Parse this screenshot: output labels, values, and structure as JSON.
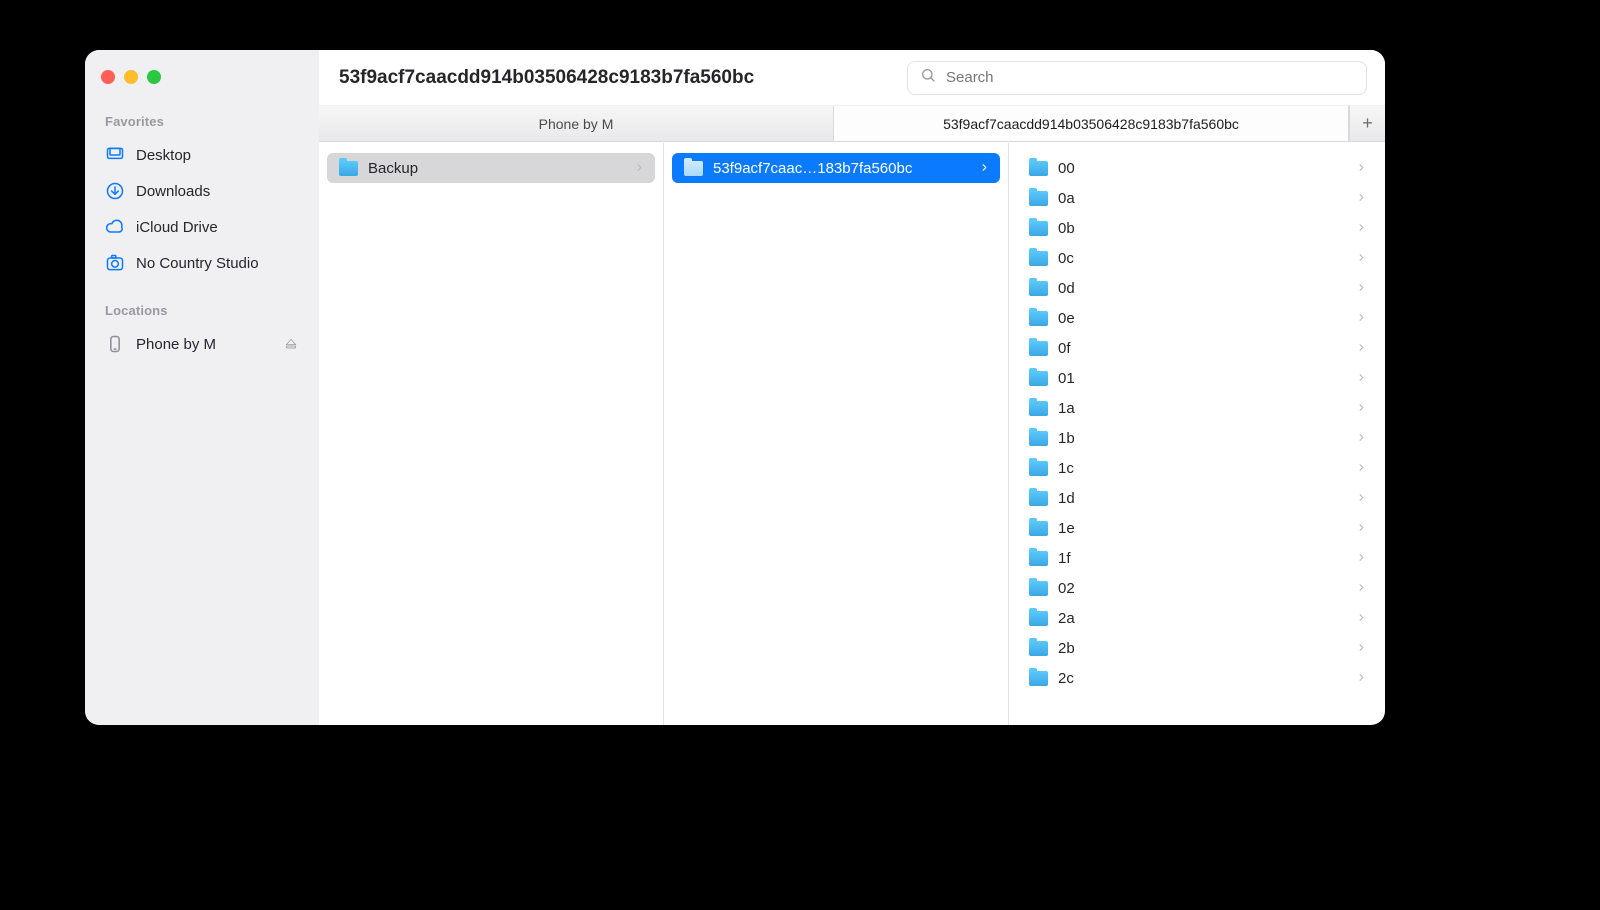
{
  "window": {
    "title": "53f9acf7caacdd914b03506428c9183b7fa560bc"
  },
  "search": {
    "placeholder": "Search"
  },
  "sidebar": {
    "sections": [
      {
        "header": "Favorites",
        "items": [
          {
            "label": "Desktop",
            "icon": "desktop-icon"
          },
          {
            "label": "Downloads",
            "icon": "download-icon"
          },
          {
            "label": "iCloud Drive",
            "icon": "cloud-icon"
          },
          {
            "label": "No Country Studio",
            "icon": "camera-icon"
          }
        ]
      },
      {
        "header": "Locations",
        "items": [
          {
            "label": "Phone by M",
            "icon": "phone-icon",
            "eject": true
          }
        ]
      }
    ]
  },
  "tabs": {
    "items": [
      {
        "label": "Phone by M"
      },
      {
        "label": "53f9acf7caacdd914b03506428c9183b7fa560bc",
        "active": true
      }
    ]
  },
  "columns": [
    {
      "items": [
        {
          "label": "Backup",
          "selected": "gray"
        }
      ]
    },
    {
      "items": [
        {
          "label": "53f9acf7caac…183b7fa560bc",
          "selected": "blue"
        }
      ]
    },
    {
      "items": [
        {
          "label": "00"
        },
        {
          "label": "0a"
        },
        {
          "label": "0b"
        },
        {
          "label": "0c"
        },
        {
          "label": "0d"
        },
        {
          "label": "0e"
        },
        {
          "label": "0f"
        },
        {
          "label": "01"
        },
        {
          "label": "1a"
        },
        {
          "label": "1b"
        },
        {
          "label": "1c"
        },
        {
          "label": "1d"
        },
        {
          "label": "1e"
        },
        {
          "label": "1f"
        },
        {
          "label": "02"
        },
        {
          "label": "2a"
        },
        {
          "label": "2b"
        },
        {
          "label": "2c"
        }
      ]
    }
  ]
}
